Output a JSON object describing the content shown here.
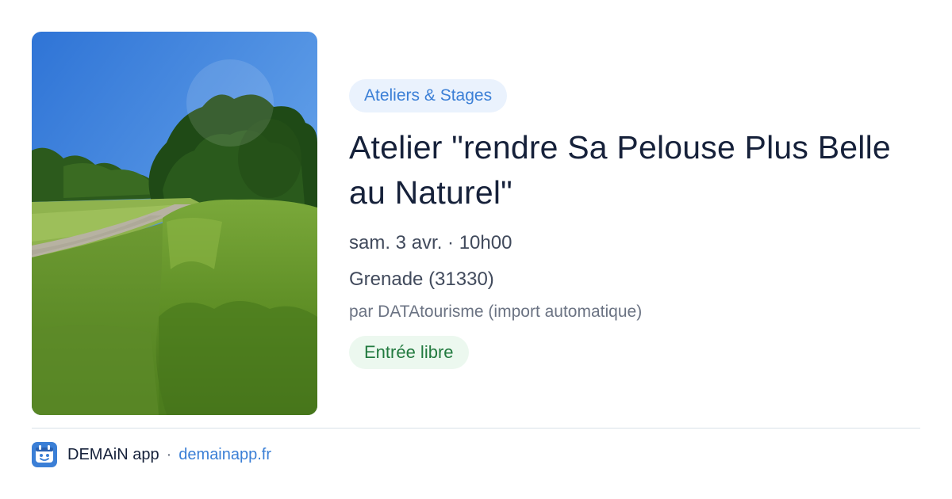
{
  "event": {
    "category": "Ateliers & Stages",
    "title": "Atelier \"rendre Sa Pelouse Plus Belle au Naturel\"",
    "date": "sam. 3 avr. · 10h00",
    "location": "Grenade (31330)",
    "organizer": "par DATAtourisme (import automatique)",
    "price": "Entrée libre"
  },
  "footer": {
    "app_name": "DEMAiN app",
    "separator": "·",
    "domain": "demainapp.fr"
  },
  "colors": {
    "accent": "#3b7fd6",
    "category_bg": "#eaf2fd",
    "price_text": "#227a3f",
    "price_bg": "#ecf8ef",
    "title": "#16213a"
  },
  "icons": {
    "app": "demain-app-icon"
  }
}
